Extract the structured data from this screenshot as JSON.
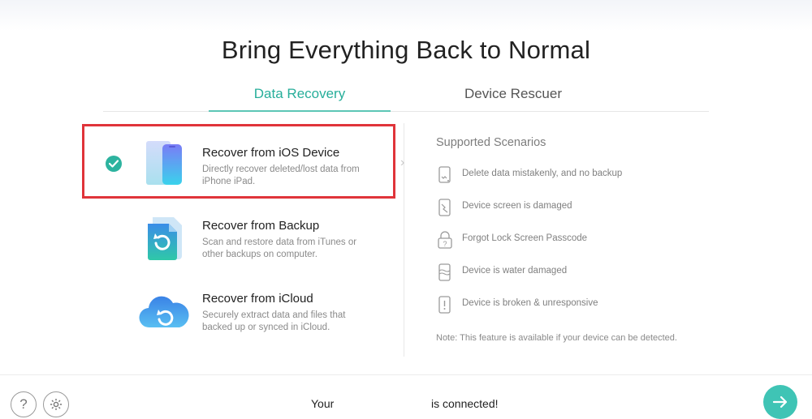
{
  "header": {
    "title": "Bring Everything Back to Normal"
  },
  "tabs": [
    {
      "label": "Data Recovery",
      "active": true
    },
    {
      "label": "Device Rescuer",
      "active": false
    }
  ],
  "options": [
    {
      "title": "Recover from iOS Device",
      "description": "Directly recover deleted/lost data from iPhone iPad.",
      "selected": true,
      "icon": "phone-icon"
    },
    {
      "title": "Recover from Backup",
      "description": "Scan and restore data from iTunes or other backups on computer.",
      "selected": false,
      "icon": "backup-file-icon"
    },
    {
      "title": "Recover from iCloud",
      "description": "Securely extract data and files that backed up or synced in iCloud.",
      "selected": false,
      "icon": "cloud-restore-icon"
    }
  ],
  "scenarios": {
    "title": "Supported Scenarios",
    "items": [
      {
        "text": "Delete data mistakenly, and no backup",
        "icon": "deleted-data-icon"
      },
      {
        "text": "Device screen is damaged",
        "icon": "broken-screen-icon"
      },
      {
        "text": "Forgot Lock Screen Passcode",
        "icon": "lock-icon"
      },
      {
        "text": "Device is water damaged",
        "icon": "water-damage-icon"
      },
      {
        "text": "Device is broken & unresponsive",
        "icon": "broken-device-icon"
      }
    ],
    "note": "Note: This feature is available if your device can be detected."
  },
  "footer": {
    "status_left": "Your",
    "status_right": "is connected!",
    "help_icon": "help-icon",
    "settings_icon": "settings-icon",
    "next_icon": "arrow-right-icon"
  },
  "colors": {
    "accent": "#2db39f",
    "highlight_border": "#e0343a",
    "next_button": "#3fc4b5"
  }
}
